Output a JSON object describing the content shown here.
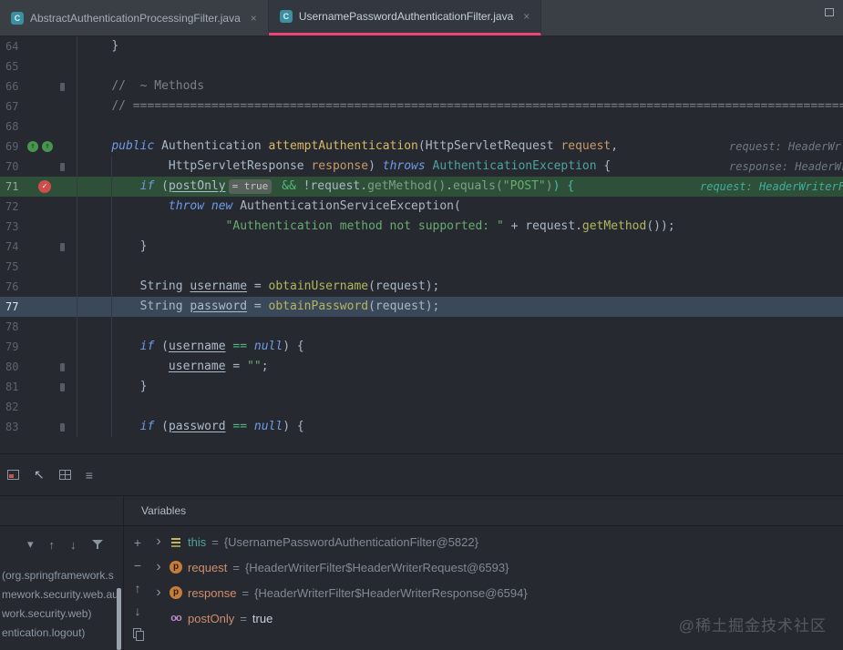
{
  "tabs": [
    {
      "label": "AbstractAuthenticationProcessingFilter.java"
    },
    {
      "label": "UsernamePasswordAuthenticationFilter.java"
    }
  ],
  "icons": {
    "close": "×",
    "check": "✓",
    "chevron_down": "▾",
    "chevron_right": "›",
    "arrow_up": "↑",
    "arrow_down": "↓",
    "plus": "+",
    "minus": "−",
    "cursor": "↖",
    "menu_lines": "≡",
    "class_letter": "C",
    "param_letter": "p",
    "field_glyph": "oo"
  },
  "colors": {
    "accent_pink": "#ee4377",
    "breakpoint_red": "#d14d4d",
    "execution_line_green": "#2f5038",
    "caret_line_blue": "#3b4859",
    "string_green": "#69aa71",
    "keyword_blue": "#6f9be5"
  },
  "editor": {
    "lines": [
      {
        "n": "64",
        "indent": 1,
        "tokens": [
          {
            "t": "}",
            "c": "p"
          }
        ]
      },
      {
        "n": "65",
        "tokens": []
      },
      {
        "n": "66",
        "indent": 1,
        "fold": true,
        "tokens": [
          {
            "t": "//  ~ Methods",
            "c": "com"
          }
        ]
      },
      {
        "n": "67",
        "indent": 1,
        "tokens": [
          {
            "t": "// =========================================================================================================",
            "c": "com"
          }
        ]
      },
      {
        "n": "68",
        "tokens": []
      },
      {
        "n": "69",
        "indent": 1,
        "icons": "override",
        "hint": "request: HeaderWr",
        "tokens": [
          {
            "t": "public ",
            "c": "kw"
          },
          {
            "t": "Authentication ",
            "c": "p"
          },
          {
            "t": "attemptAuthentication",
            "c": "md"
          },
          {
            "t": "(HttpServletRequest ",
            "c": "p"
          },
          {
            "t": "request",
            "c": "prm"
          },
          {
            "t": ",",
            "c": "p"
          }
        ]
      },
      {
        "n": "70",
        "indent": 3,
        "guide": true,
        "fold": true,
        "hint": "response: HeaderWr",
        "tokens": [
          {
            "t": "HttpServletResponse ",
            "c": "p"
          },
          {
            "t": "response",
            "c": "prm"
          },
          {
            "t": ") ",
            "c": "p"
          },
          {
            "t": "throws ",
            "c": "kw"
          },
          {
            "t": "AuthenticationException",
            "c": "type"
          },
          {
            "t": " {",
            "c": "p"
          }
        ]
      },
      {
        "n": "71",
        "indent": 2,
        "cls": "exec",
        "bp": true,
        "guide": true,
        "hint": "request: HeaderWriterFil",
        "hintc": "teal",
        "hx": 768,
        "tokens": [
          {
            "t": "if ",
            "c": "kw"
          },
          {
            "t": "(",
            "c": "p"
          },
          {
            "t": "postOnly",
            "c": "fld"
          },
          {
            "t": "= true",
            "c": "badge"
          },
          {
            "t": " && ",
            "c": "op"
          },
          {
            "t": "!request.",
            "c": "p"
          },
          {
            "t": "getMethod()",
            "c": "dim"
          },
          {
            "t": ".",
            "c": "p"
          },
          {
            "t": "equals(",
            "c": "dim"
          },
          {
            "t": "\"POST\"",
            "c": "str"
          },
          {
            "t": ")",
            "c": "dim"
          },
          {
            "t": ") {",
            "c": "teal"
          }
        ]
      },
      {
        "n": "72",
        "indent": 3,
        "guide": true,
        "tokens": [
          {
            "t": "throw new ",
            "c": "kw"
          },
          {
            "t": "AuthenticationServiceException(",
            "c": "p"
          }
        ]
      },
      {
        "n": "73",
        "indent": 5,
        "guide": true,
        "tokens": [
          {
            "t": "\"Authentication method not supported: \"",
            "c": "str"
          },
          {
            "t": " + request.",
            "c": "p"
          },
          {
            "t": "getMethod",
            "c": "mc"
          },
          {
            "t": "());",
            "c": "p"
          }
        ]
      },
      {
        "n": "74",
        "indent": 2,
        "guide": true,
        "fold": true,
        "tokens": [
          {
            "t": "}",
            "c": "p"
          }
        ]
      },
      {
        "n": "75",
        "guide": true,
        "tokens": []
      },
      {
        "n": "76",
        "indent": 2,
        "guide": true,
        "tokens": [
          {
            "t": "String ",
            "c": "p"
          },
          {
            "t": "username",
            "c": "fld"
          },
          {
            "t": " = ",
            "c": "p"
          },
          {
            "t": "obtainUsername",
            "c": "mc"
          },
          {
            "t": "(request);",
            "c": "p"
          }
        ]
      },
      {
        "n": "77",
        "indent": 2,
        "cls": "caret",
        "guide": true,
        "tokens": [
          {
            "t": "String ",
            "c": "p"
          },
          {
            "t": "password",
            "c": "fld"
          },
          {
            "t": " = ",
            "c": "p"
          },
          {
            "t": "obtainPassword",
            "c": "mc"
          },
          {
            "t": "(request);",
            "c": "p"
          }
        ]
      },
      {
        "n": "78",
        "guide": true,
        "tokens": []
      },
      {
        "n": "79",
        "indent": 2,
        "guide": true,
        "tokens": [
          {
            "t": "if ",
            "c": "kw"
          },
          {
            "t": "(",
            "c": "p"
          },
          {
            "t": "username",
            "c": "fld"
          },
          {
            "t": " == ",
            "c": "op"
          },
          {
            "t": "null",
            "c": "kw"
          },
          {
            "t": ") {",
            "c": "p"
          }
        ]
      },
      {
        "n": "80",
        "indent": 3,
        "guide": true,
        "fold": true,
        "tokens": [
          {
            "t": "username",
            "c": "fld"
          },
          {
            "t": " = ",
            "c": "p"
          },
          {
            "t": "\"\"",
            "c": "str"
          },
          {
            "t": ";",
            "c": "p"
          }
        ]
      },
      {
        "n": "81",
        "indent": 2,
        "guide": true,
        "fold": true,
        "tokens": [
          {
            "t": "}",
            "c": "p"
          }
        ]
      },
      {
        "n": "82",
        "guide": true,
        "tokens": []
      },
      {
        "n": "83",
        "indent": 2,
        "guide": true,
        "fold": true,
        "tokens": [
          {
            "t": "if ",
            "c": "kw"
          },
          {
            "t": "(",
            "c": "p"
          },
          {
            "t": "password",
            "c": "fld"
          },
          {
            "t": " == ",
            "c": "op"
          },
          {
            "t": "null",
            "c": "kw"
          },
          {
            "t": ") {",
            "c": "p"
          }
        ]
      }
    ]
  },
  "debug": {
    "variables_title": "Variables",
    "eq": "=",
    "frames": [
      "(org.springframework.s",
      "mework.security.web.au",
      "work.security.web)",
      "entication.logout)"
    ],
    "variables": [
      {
        "name": "this",
        "icon": "object",
        "name_class": "vn-teal",
        "value": "{UsernamePasswordAuthenticationFilter@5822}",
        "value_class": "val-obj",
        "expandable": true
      },
      {
        "name": "request",
        "icon": "param",
        "value": "{HeaderWriterFilter$HeaderWriterRequest@6593}",
        "value_class": "val-obj",
        "expandable": true
      },
      {
        "name": "response",
        "icon": "param",
        "value": "{HeaderWriterFilter$HeaderWriterResponse@6594}",
        "value_class": "val-obj",
        "expandable": true
      },
      {
        "name": "postOnly",
        "icon": "field",
        "value": "true",
        "value_class": "val-prim",
        "expandable": false
      }
    ]
  },
  "watermark": "@稀土掘金技术社区"
}
